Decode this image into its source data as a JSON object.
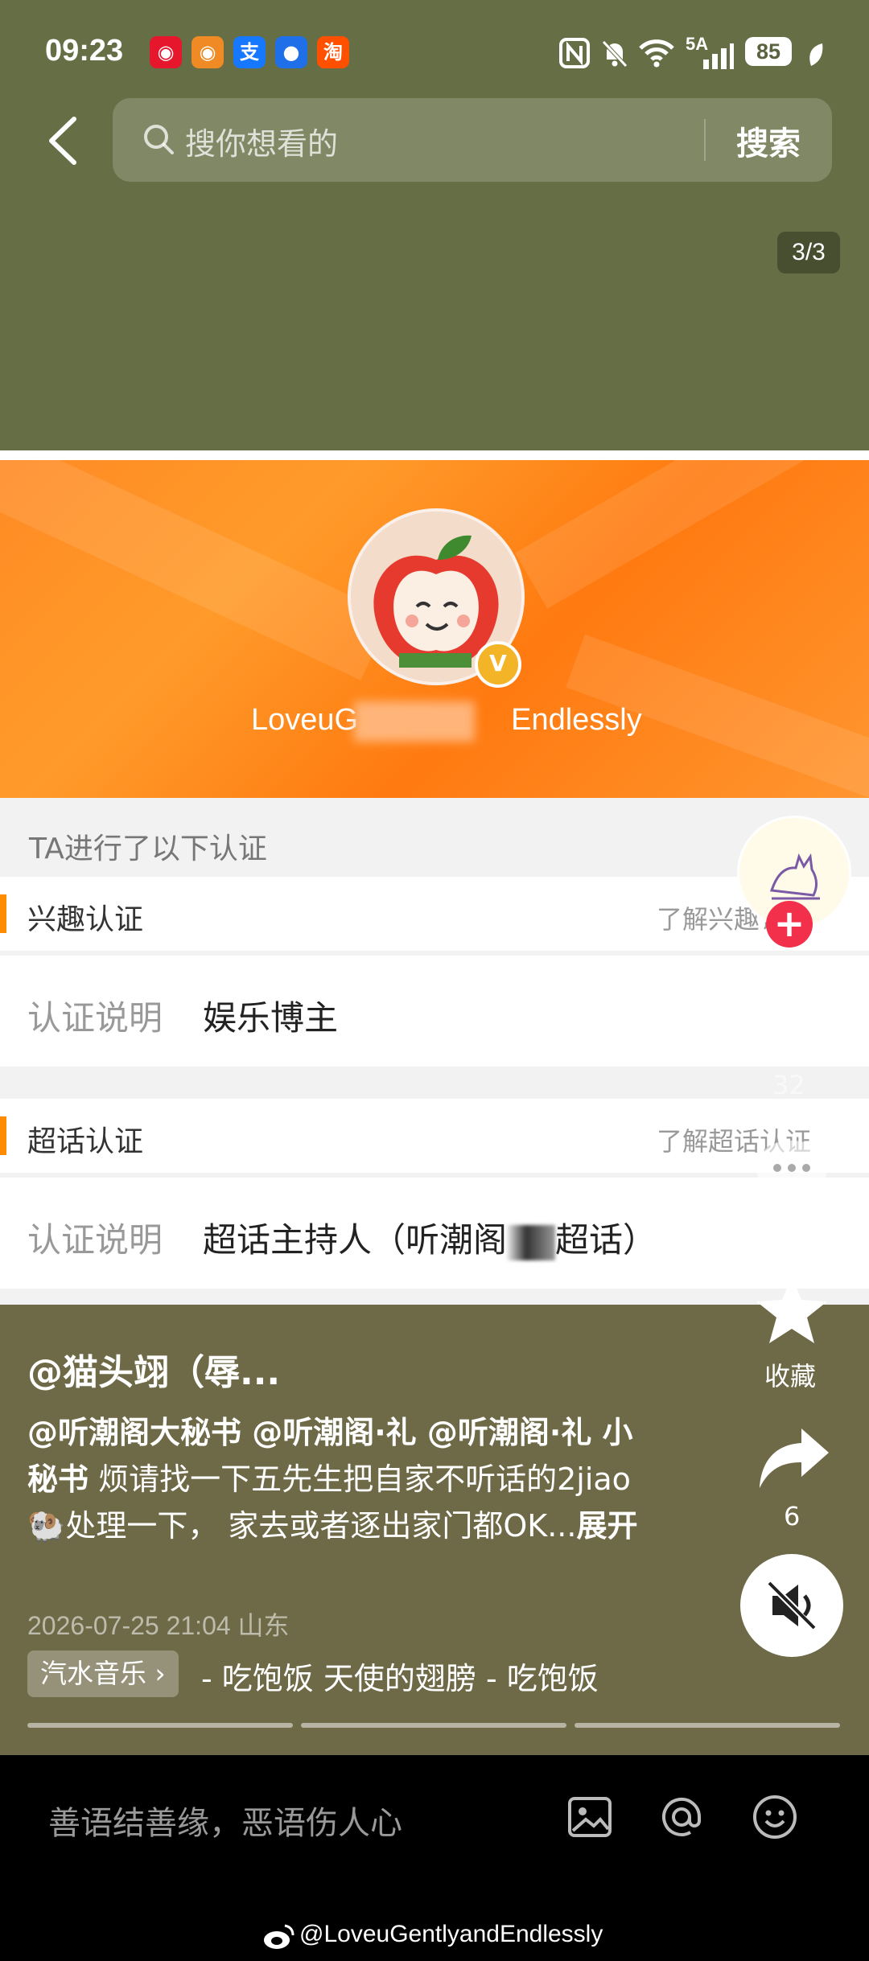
{
  "status_bar": {
    "time": "09:23",
    "app_icons": [
      "weibo-icon",
      "weibo-alt-icon",
      "alipay-icon",
      "qq-icon",
      "taobao-icon"
    ],
    "app_icon_labels": [
      "",
      "",
      "支",
      "",
      "淘"
    ],
    "network": "5A",
    "battery": "85"
  },
  "search": {
    "placeholder": "搜你想看的",
    "button": "搜索"
  },
  "pager": "3/3",
  "profile": {
    "username_visible_start": "LoveuG",
    "username_visible_end": "Endlessly"
  },
  "certification": {
    "heading": "TA进行了以下认证",
    "items": [
      {
        "title": "兴趣认证",
        "link": "了解兴趣认证",
        "desc_label": "认证说明",
        "desc_value": "娱乐博主"
      },
      {
        "title": "超话认证",
        "link": "了解超话认证",
        "desc_label": "认证说明",
        "desc_value_start": "超话主持人（听潮阁",
        "desc_value_end": "超话）"
      }
    ]
  },
  "post": {
    "author": "@猫头翊（辱...",
    "mentions": "@听潮阁大秘书 @听潮阁·礼 @听潮阁·礼 小秘书",
    "text": " 烦请找一下五先生把自家不听话的2jiao🐏处理一下，   家去或者逐出家门都OK...",
    "expand": "展开",
    "meta": "2026-07-25 21:04 山东",
    "music_tag": "汽水音乐",
    "music_text": "- 吃饱饭  天使的翅膀 - 吃饱饭"
  },
  "actions": {
    "like_count": "32",
    "favorite_label": "收藏",
    "share_count": "6"
  },
  "comment_bar": {
    "placeholder": "善语结善缘，恶语伤人心"
  },
  "watermark": "@LoveuGentlyandEndlessly",
  "colors": {
    "top_bg": "#656e45",
    "overlay_bg": "#6e6946",
    "banner_orange": "#ff8a24",
    "accent_orange": "#ff8c00",
    "follow_red": "#f3304b"
  }
}
